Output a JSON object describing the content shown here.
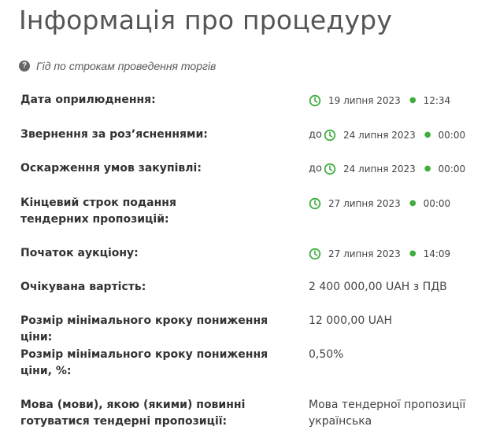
{
  "page": {
    "title": "Інформація про процедуру",
    "guide_label": "Гід по строкам проведення торгів"
  },
  "rows": [
    {
      "label": "Дата оприлюднення:",
      "prefix": "",
      "date": "19 липня 2023",
      "time": "12:34"
    },
    {
      "label": "Звернення за роз’ясненнями:",
      "prefix": "до",
      "date": "24 липня 2023",
      "time": "00:00"
    },
    {
      "label": "Оскарження умов закупівлі:",
      "prefix": "до",
      "date": "24 липня 2023",
      "time": "00:00"
    },
    {
      "label": "Кінцевий строк подання тендерних пропозицій:",
      "prefix": "",
      "date": "27 липня 2023",
      "time": "00:00"
    },
    {
      "label": "Початок аукціону:",
      "prefix": "",
      "date": "27 липня 2023",
      "time": "14:09"
    },
    {
      "label": "Очікувана вартість:",
      "value": "2 400 000,00 UAH з ПДВ"
    },
    {
      "label": "Розмір мінімального кроку пониження ціни:",
      "value": "12 000,00 UAH"
    },
    {
      "label": "Розмір мінімального кроку пониження ціни, %:",
      "value": "0,50%"
    },
    {
      "label": "Мова (мови), якою (якими) повинні готуватися тендерні пропозиції:",
      "value": "Мова тендерної пропозиції українська"
    }
  ],
  "colors": {
    "accent_green": "#3fae3f",
    "text": "#333333",
    "title": "#555555"
  },
  "icons": {
    "guide": "question-circle-icon",
    "date": "clock-icon"
  }
}
